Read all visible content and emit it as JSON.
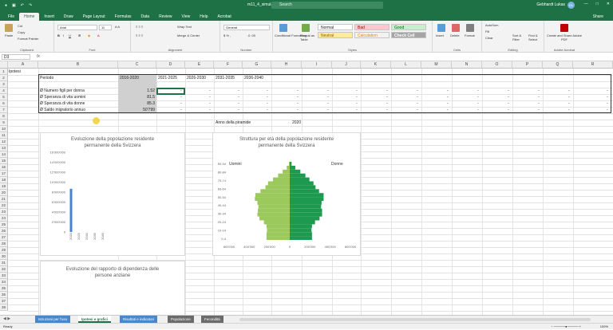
{
  "app": {
    "title": "m11_4_simulation_2022.xlsx - Excel",
    "search_placeholder": "Search",
    "user": "Gebhardt Lukas",
    "avatar_initials": "GL",
    "accent": "#1e7145"
  },
  "tabs": [
    {
      "label": "File"
    },
    {
      "label": "Home"
    },
    {
      "label": "Insert"
    },
    {
      "label": "Draw"
    },
    {
      "label": "Page Layout"
    },
    {
      "label": "Formulas"
    },
    {
      "label": "Data"
    },
    {
      "label": "Review"
    },
    {
      "label": "View"
    },
    {
      "label": "Help"
    },
    {
      "label": "Acrobat"
    }
  ],
  "share_label": "Share",
  "ribbon": {
    "clipboard": {
      "paste": "Paste",
      "cut": "Cut",
      "copy": "Copy",
      "format_painter": "Format Painter",
      "label": "Clipboard"
    },
    "font": {
      "family": "Arial",
      "size": "11",
      "label": "Font"
    },
    "alignment": {
      "wrap": "Wrap Text",
      "merge": "Merge & Center",
      "label": "Alignment"
    },
    "number": {
      "format": "General",
      "label": "Number"
    },
    "styles": {
      "cond_format": "Conditional Formatting",
      "format_table": "Format as Table",
      "normal": "Normal",
      "bad": "Bad",
      "good": "Good",
      "neutral": "Neutral",
      "calculation": "Calculation",
      "check_cell": "Check Cell",
      "label": "Styles"
    },
    "cells": {
      "insert": "Insert",
      "delete": "Delete",
      "format": "Format",
      "label": "Cells"
    },
    "editing": {
      "autosum": "AutoSum",
      "fill": "Fill",
      "clear": "Clear",
      "sort": "Sort & Filter",
      "find": "Find & Select",
      "label": "Editing"
    },
    "adobe": {
      "create": "Create and Share Adobe PDF",
      "label": "Adobe Acrobat"
    }
  },
  "formula_bar": {
    "name_box": "D3",
    "fx": "fx"
  },
  "columns": [
    "A",
    "B",
    "C",
    "D",
    "E",
    "F",
    "G",
    "H",
    "I",
    "J",
    "K",
    "L",
    "M",
    "N",
    "O",
    "P",
    "Q",
    "R"
  ],
  "rows": [
    "1",
    "2",
    "3",
    "4",
    "5",
    "6",
    "7",
    "8",
    "9",
    "10",
    "11",
    "12",
    "13",
    "14",
    "15",
    "16",
    "17",
    "18",
    "19",
    "20",
    "21",
    "22",
    "23",
    "24",
    "25",
    "26",
    "27",
    "28",
    "29",
    "30",
    "31",
    "32",
    "33",
    "34",
    "35",
    "36",
    "37",
    "38"
  ],
  "sheet": {
    "a1": "Ipotesi",
    "header": {
      "periodo": "Periodo",
      "p1": "2016-2020",
      "p2": "2021-2025",
      "p3": "2026-2030",
      "p4": "2031-2035",
      "p5": "2036-2040"
    },
    "rows": [
      {
        "label": "Ø Numero figli per donna",
        "value": "1.52"
      },
      {
        "label": "Ø Speranza di vita uomini",
        "value": "81.5"
      },
      {
        "label": "Ø Speranza di vita donne",
        "value": "85.3"
      },
      {
        "label": "Ø Saldo migratorio annuo",
        "value": "50'799"
      }
    ],
    "dash": "-",
    "anno_label": "Anno della piramide",
    "anno_value": "2020"
  },
  "chart1": {
    "title_line1": "Evoluzione della popolazione residente",
    "title_line2": "permanente della Svizzera",
    "yticks": [
      "16'000'000",
      "14'000'000",
      "12'000'000",
      "10'000'000",
      "8'000'000",
      "6'000'000",
      "4'000'000",
      "2'000'000",
      "0"
    ],
    "xticks": [
      "2020",
      "2025",
      "2030",
      "2035",
      "2040"
    ]
  },
  "chart2": {
    "title_line1": "Struttura per età della popolazione residente",
    "title_line2": "permanente della Svizzera",
    "men": "Uomini",
    "women": "Donne",
    "age_labels": [
      "90-94",
      "80-84",
      "70-74",
      "60-64",
      "50-54",
      "40-44",
      "30-34",
      "20-24",
      "10-14",
      "0-4"
    ],
    "xticks": [
      "600'000",
      "400'000",
      "200'000",
      "0",
      "200'000",
      "400'000",
      "600'000"
    ],
    "color_men": "#9bc95c",
    "color_women": "#1e9a50"
  },
  "chart3": {
    "title_line1": "Evoluzione del rapporto di dipendenza delle",
    "title_line2": "persone anziane"
  },
  "chart_data": [
    {
      "type": "bar",
      "title": "Evoluzione della popolazione residente permanente della Svizzera",
      "categories": [
        "2020",
        "2025",
        "2030",
        "2035",
        "2040"
      ],
      "values": [
        8670000,
        null,
        null,
        null,
        null
      ],
      "ylim": [
        0,
        16000000
      ]
    },
    {
      "type": "bar",
      "title": "Struttura per età della popolazione residente permanente della Svizzera",
      "categories": [
        "0-4",
        "5-9",
        "10-14",
        "15-19",
        "20-24",
        "25-29",
        "30-34",
        "35-39",
        "40-44",
        "45-49",
        "50-54",
        "55-59",
        "60-64",
        "65-69",
        "70-74",
        "75-79",
        "80-84",
        "85-89",
        "90-94",
        "95-99"
      ],
      "series": [
        {
          "name": "Uomini",
          "values": [
            -230000,
            -230000,
            -225000,
            -230000,
            -255000,
            -300000,
            -320000,
            -315000,
            -310000,
            -320000,
            -345000,
            -340000,
            -290000,
            -240000,
            -215000,
            -165000,
            -115000,
            -70000,
            -30000,
            -8000
          ]
        },
        {
          "name": "Donne",
          "values": [
            220000,
            220000,
            215000,
            220000,
            250000,
            295000,
            320000,
            320000,
            310000,
            315000,
            335000,
            335000,
            290000,
            255000,
            235000,
            195000,
            155000,
            105000,
            55000,
            18000
          ]
        }
      ],
      "xlim": [
        -600000,
        600000
      ]
    },
    {
      "type": "line",
      "title": "Evoluzione del rapporto di dipendenza delle persone anziane",
      "series": []
    }
  ],
  "sheet_tabs": [
    {
      "label": "Istruzioni per l'uso",
      "color": "#4a86c8"
    },
    {
      "label": "Ipotesi e grafici",
      "color": "#ffffff"
    },
    {
      "label": "Risultati e indicatori",
      "color": "#4a86c8"
    },
    {
      "label": "Popolazione",
      "color": "#6b6b6b"
    },
    {
      "label": "Fecondità",
      "color": "#6b6b6b"
    }
  ],
  "status": {
    "ready": "Ready",
    "zoom": "100%"
  }
}
